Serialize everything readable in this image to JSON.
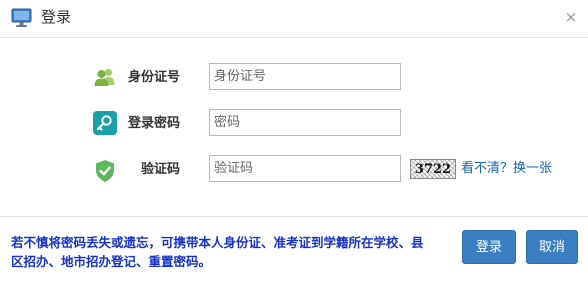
{
  "header": {
    "title": "登录",
    "icon": "monitor-icon",
    "close_label": "×"
  },
  "form": {
    "id_card": {
      "label": "身份证号",
      "placeholder": "身份证号",
      "icon": "users-icon",
      "icon_color": "#8cb94a"
    },
    "password": {
      "label": "登录密码",
      "placeholder": "密码",
      "icon": "key-icon",
      "icon_color": "#19a0a8"
    },
    "captcha": {
      "label": "验证码",
      "placeholder": "验证码",
      "icon": "shield-icon",
      "icon_color": "#5cb85c",
      "code": "3722",
      "refresh_label": "看不清？换一张"
    }
  },
  "footer": {
    "notice": "若不慎将密码丢失或遗忘，可携带本人身份证、准考证到学籍所在学校、县区招办、地市招办登记、重置密码。",
    "notice_color": "#1732c9",
    "login_label": "登录",
    "cancel_label": "取消",
    "button_color": "#3a7fc1"
  }
}
